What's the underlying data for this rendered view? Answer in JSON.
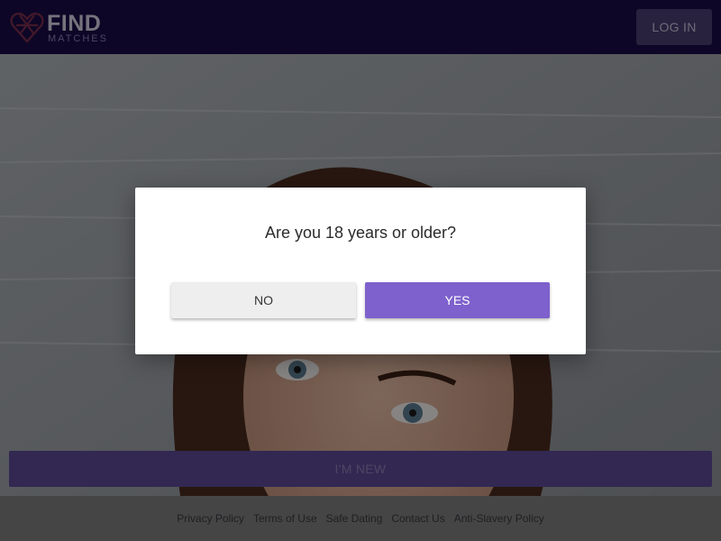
{
  "header": {
    "logo": {
      "line1": "FIND",
      "line2": "MATCHES"
    },
    "login_label": "LOG IN"
  },
  "hero": {
    "im_new_label": "I'M NEW"
  },
  "modal": {
    "question": "Are you 18 years or older?",
    "no_label": "NO",
    "yes_label": "YES"
  },
  "footer": {
    "links": [
      "Privacy Policy",
      "Terms of Use",
      "Safe Dating",
      "Contact Us",
      "Anti-Slavery Policy"
    ]
  },
  "colors": {
    "header_bg": "#1a0b45",
    "accent": "#7e61cc",
    "cta": "#5b4a96"
  },
  "icons": [
    "heart-logo-icon"
  ]
}
